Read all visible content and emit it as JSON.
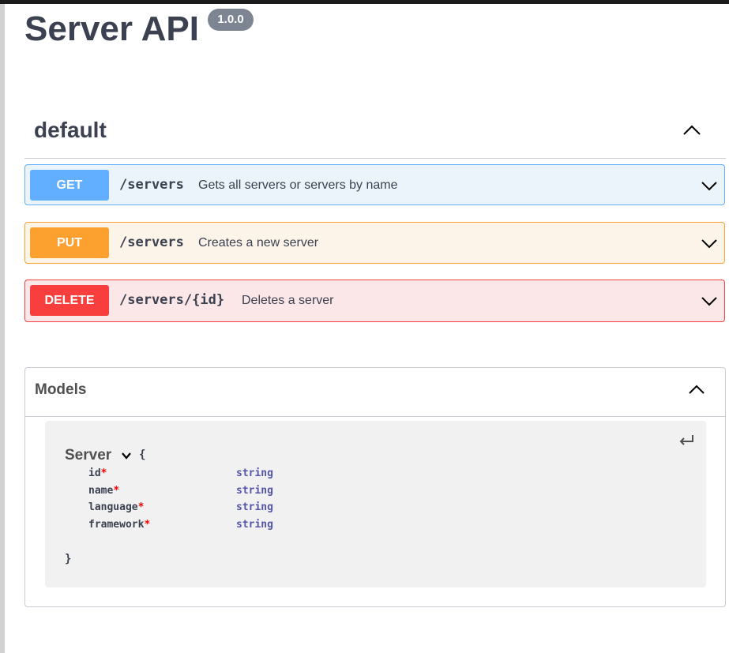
{
  "header": {
    "title": "Server API",
    "version": "1.0.0"
  },
  "tag": {
    "name": "default"
  },
  "operations": [
    {
      "method": "GET",
      "path": "/servers",
      "summary": "Gets all servers or servers by name"
    },
    {
      "method": "PUT",
      "path": "/servers",
      "summary": "Creates a new server"
    },
    {
      "method": "DELETE",
      "path": "/servers/{id}",
      "summary": "Deletes a server"
    }
  ],
  "models": {
    "title": "Models",
    "schema": {
      "name": "Server",
      "open_brace": "{",
      "close_brace": "}",
      "required_marker": "*",
      "properties": [
        {
          "name": "id",
          "type": "string"
        },
        {
          "name": "name",
          "type": "string"
        },
        {
          "name": "language",
          "type": "string"
        },
        {
          "name": "framework",
          "type": "string"
        }
      ]
    }
  },
  "colors": {
    "get": "#61affe",
    "put": "#fca130",
    "delete": "#f93e3e"
  },
  "icons": {
    "tag_toggle": "chevron-up-icon",
    "operation_toggle": "chevron-down-icon",
    "models_toggle": "chevron-up-icon",
    "model_collapse": "return-arrow-icon",
    "model_toggle": "chevron-down-icon"
  }
}
